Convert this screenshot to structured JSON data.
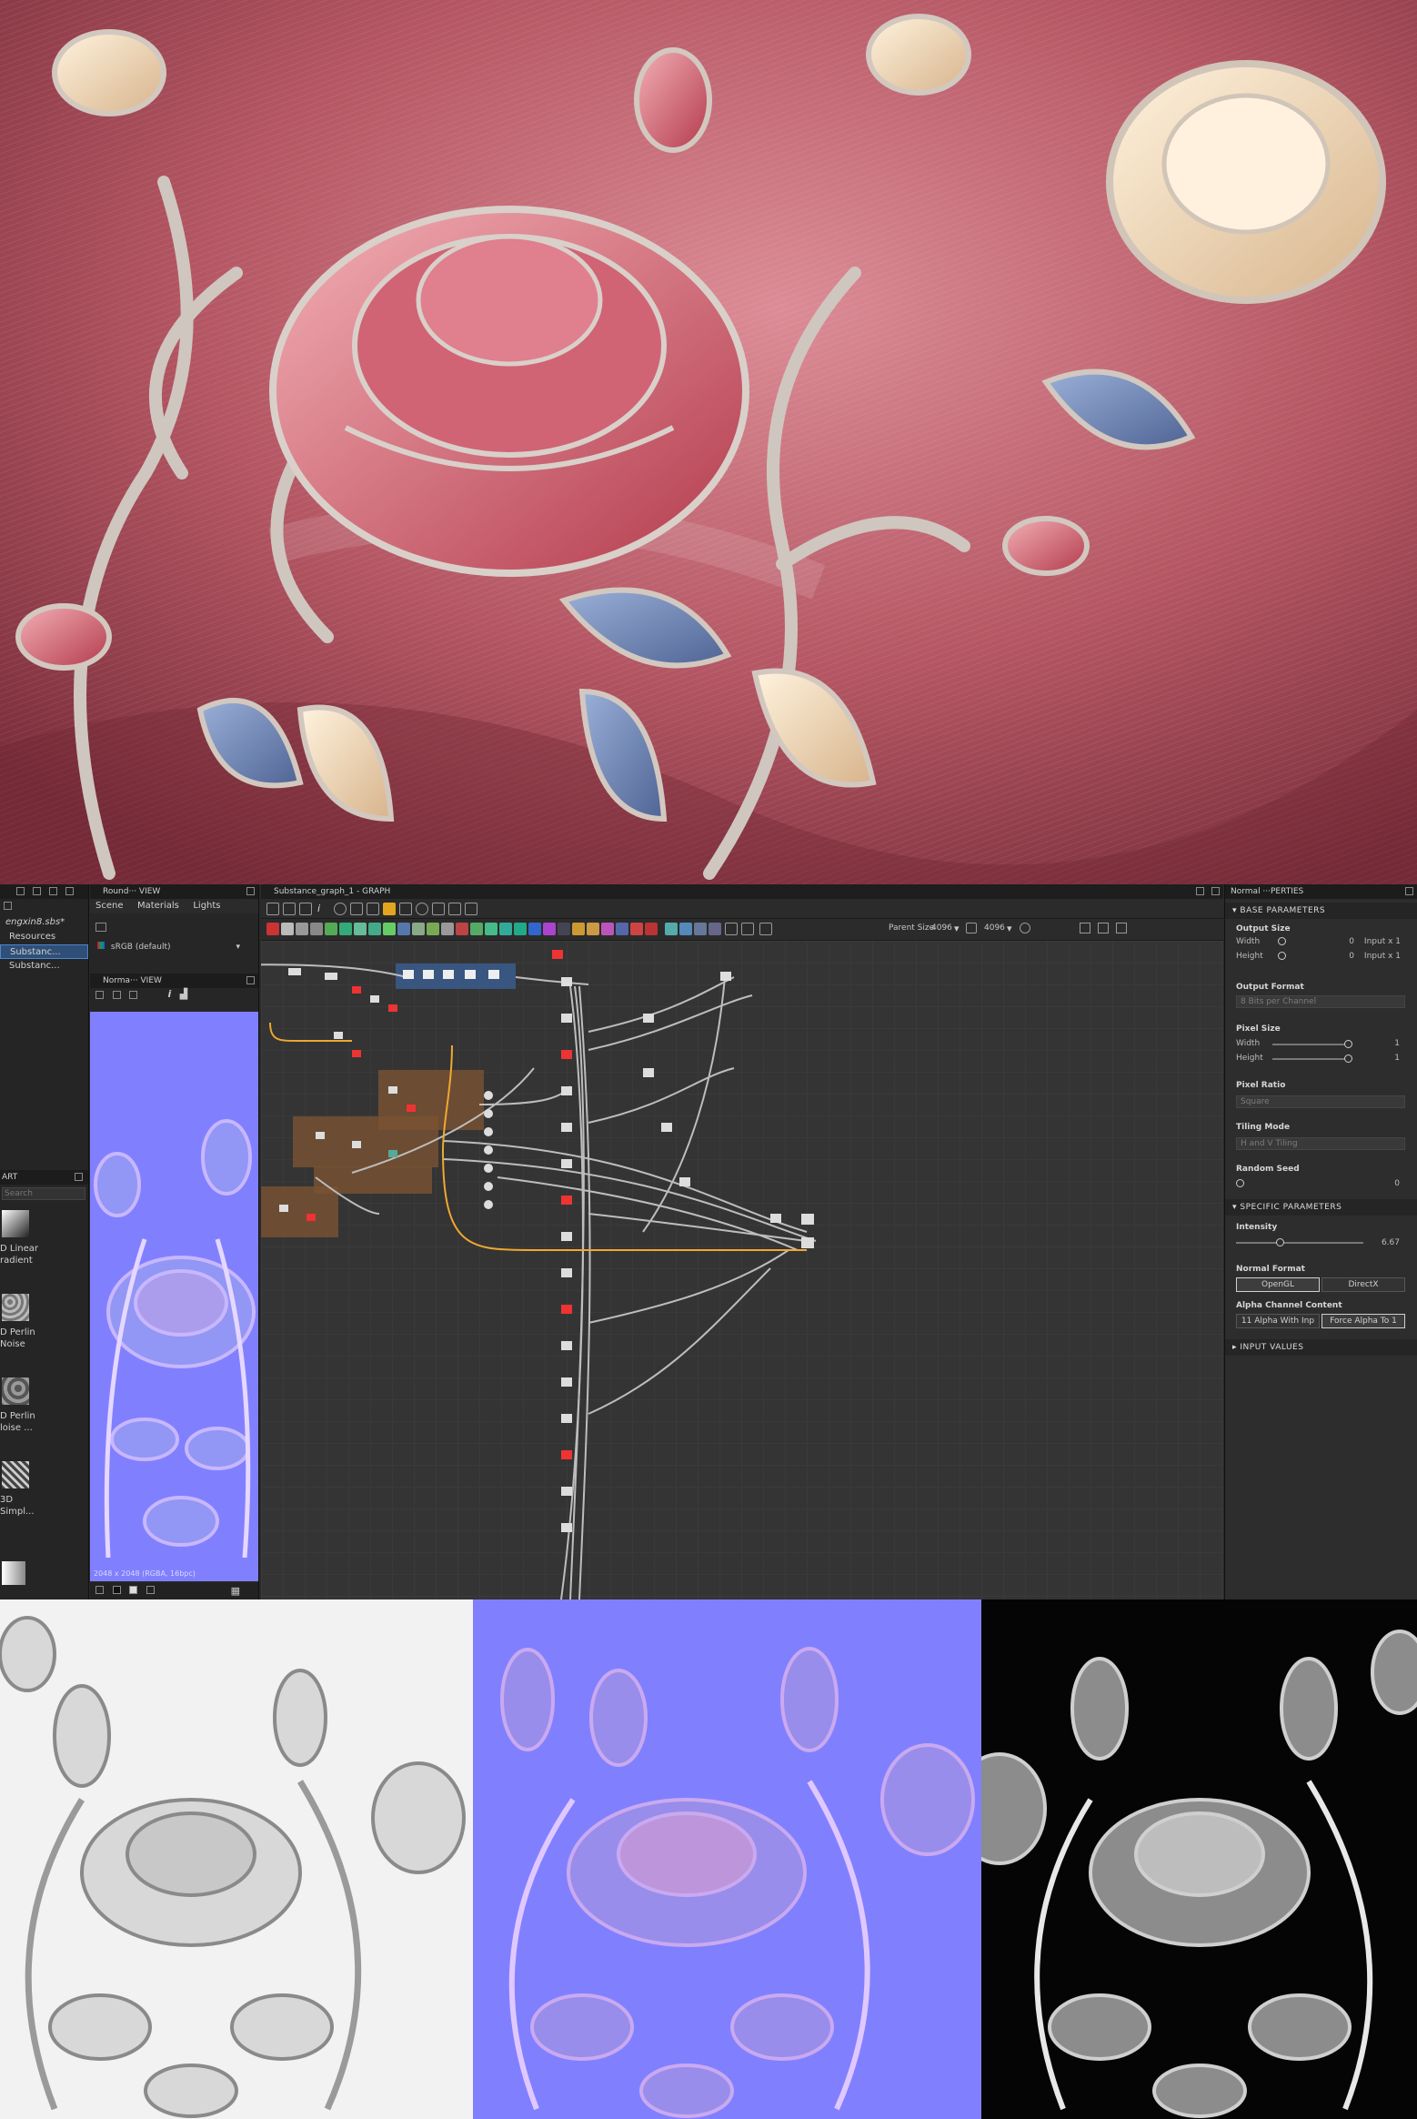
{
  "explorer": {
    "package_name": "engxin8.sbs*",
    "items": [
      {
        "label": "Resources"
      },
      {
        "label": "Substanc..."
      },
      {
        "label": "Substanc..."
      }
    ],
    "library_title": "ART",
    "search_placeholder": "Search",
    "library_items": [
      {
        "label": "D Linear\nradient"
      },
      {
        "label": "D Perlin\nNoise"
      },
      {
        "label": "D Perlin\nloise ..."
      },
      {
        "label": "3D\nSimpl..."
      }
    ]
  },
  "view3d": {
    "title": "Round··· VIEW",
    "tabs": [
      "Scene",
      "Materials",
      "Lights"
    ],
    "colorspace": "sRGB (default)"
  },
  "view2d": {
    "title": "Norma··· VIEW",
    "status": "2048 x 2048 (RGBA, 16bpc)"
  },
  "graph": {
    "title": "Substance_graph_1 - GRAPH",
    "parent_size_label": "Parent Size",
    "parent_size_w": "4096",
    "parent_size_h": "4096"
  },
  "properties": {
    "title": "Normal ···PERTIES",
    "sections": {
      "base": "BASE PARAMETERS",
      "specific": "SPECIFIC PARAMETERS",
      "inputs": "INPUT VALUES"
    },
    "output_size": {
      "label": "Output Size",
      "width_label": "Width",
      "width_val": "0",
      "width_mode": "Input x 1",
      "height_label": "Height",
      "height_val": "0",
      "height_mode": "Input x 1"
    },
    "output_format": {
      "label": "Output Format",
      "value": "8 Bits per Channel"
    },
    "pixel_size": {
      "label": "Pixel Size",
      "width_label": "Width",
      "width_val": "1",
      "height_label": "Height",
      "height_val": "1"
    },
    "pixel_ratio": {
      "label": "Pixel Ratio",
      "value": "Square"
    },
    "tiling_mode": {
      "label": "Tiling Mode",
      "value": "H and V Tiling"
    },
    "random_seed": {
      "label": "Random Seed",
      "value": "0"
    },
    "intensity": {
      "label": "Intensity",
      "value": "6.67",
      "fraction": 0.33
    },
    "normal_format": {
      "label": "Normal Format",
      "options": [
        "OpenGL",
        "DirectX"
      ],
      "selected": "OpenGL"
    },
    "alpha_channel": {
      "label": "Alpha Channel Content",
      "options": [
        "11 Alpha With Inp",
        "Force Alpha To 1"
      ],
      "selected": "Force Alpha To 1"
    }
  },
  "colors": {
    "fabric_pink": "#b35462",
    "normal_blue": "#8080ff",
    "selection_blue": "#4d86c9",
    "graph_bg": "#343434",
    "frame_brown": "#7a5232",
    "link_orange": "#f0a830"
  }
}
